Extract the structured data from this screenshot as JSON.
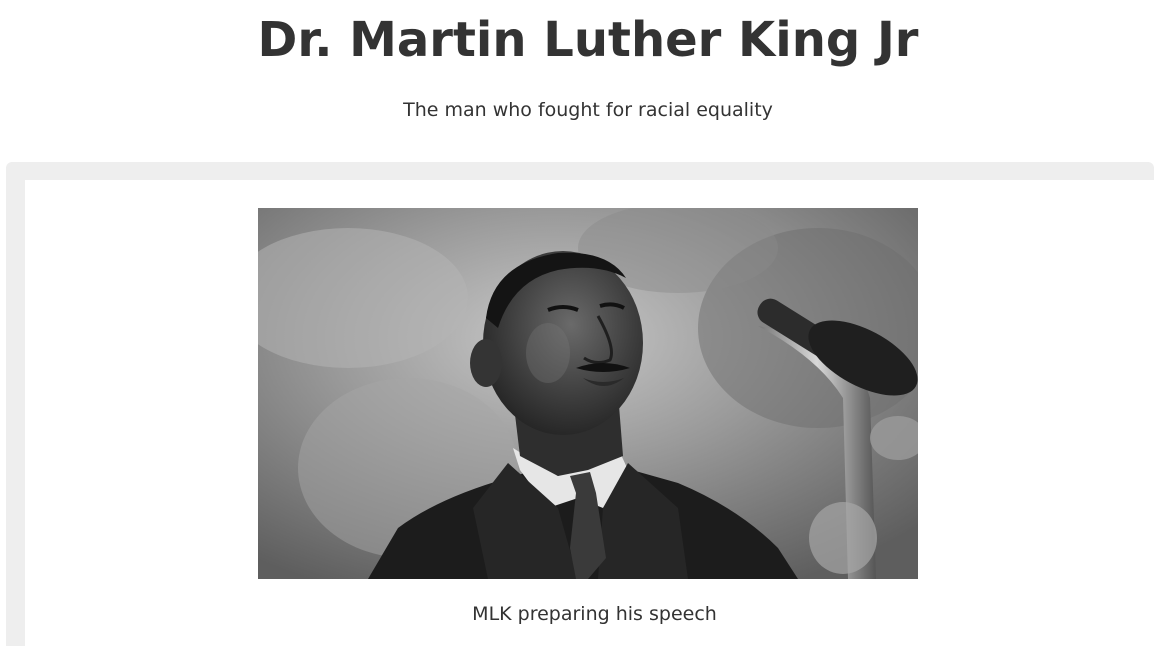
{
  "header": {
    "title": "Dr. Martin Luther King Jr",
    "subtitle": "The man who fought for racial equality"
  },
  "figure": {
    "caption": "MLK preparing his speech",
    "photo_subject": "black-and-white portrait of Martin Luther King Jr at a microphone"
  }
}
